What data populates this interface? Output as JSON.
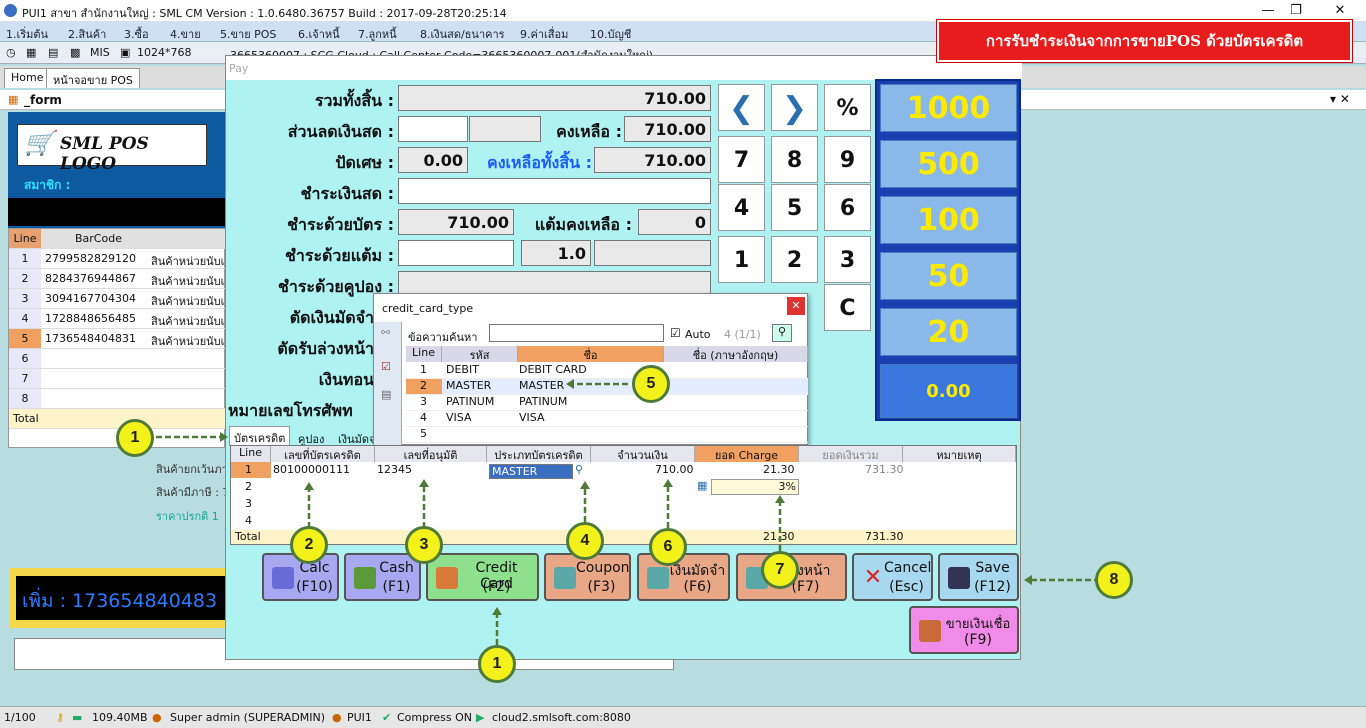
{
  "window": {
    "title": "PUI1 สาขา สำนักงานใหญ่ : SML CM Version : 1.0.6480.36757  Build : 2017-09-28T20:25:14"
  },
  "menu": [
    "1.เริ่มต้น",
    "2.สินค้า",
    "3.ซื้อ",
    "4.ขาย",
    "5.ขาย POS",
    "6.เจ้าหนี้",
    "7.ลูกหนี้",
    "8.เงินสด/ธนาคาร",
    "9.ค่าเสื่อม",
    "10.บัญชี"
  ],
  "toolbar": {
    "mis": "MIS",
    "resolution": "1024*768",
    "info": "3665360007 : SCG Cloud : Call Center Code=3665360007-001(สำนักงานใหญ่)"
  },
  "tabs": {
    "home": "Home",
    "pos": "หน้าจอขาย POS"
  },
  "form": {
    "title": "_form",
    "logo": "SML POS LOGO",
    "member": "สมาชิก :"
  },
  "bg_grid": {
    "headers": [
      "Line",
      "BarCode"
    ],
    "rows": [
      {
        "line": "1",
        "barcode": "2799582829120",
        "name": "สินค้าหน่วยนับเ"
      },
      {
        "line": "2",
        "barcode": "8284376944867",
        "name": "สินค้าหน่วยนับเ"
      },
      {
        "line": "3",
        "barcode": "3094167704304",
        "name": "สินค้าหน่วยนับเ"
      },
      {
        "line": "4",
        "barcode": "1728848656485",
        "name": "สินค้าหน่วยนับเ"
      },
      {
        "line": "5",
        "barcode": "1736548404831",
        "name": "สินค้าหน่วยนับเ"
      },
      {
        "line": "6",
        "barcode": "",
        "name": ""
      },
      {
        "line": "7",
        "barcode": "",
        "name": ""
      },
      {
        "line": "8",
        "barcode": "",
        "name": ""
      }
    ],
    "total": "Total"
  },
  "bg_info": [
    "สินค้ายกเว้นภา",
    "สินค้ามีภาษี : 7",
    "ราคาปรกติ 1"
  ],
  "bg_barcode": "เพิ่ม : 173654840483",
  "pay": {
    "title": "Pay",
    "total_label": "รวมทั้งสิ้น :",
    "total": "710.00",
    "cash_discount_label": "ส่วนลดเงินสด :",
    "remaining_label": "คงเหลือ :",
    "remaining": "710.00",
    "rounding_label": "ปัดเศษ :",
    "rounding": "0.00",
    "remaining_all_label": "คงเหลือทั้งสิ้น :",
    "remaining_all": "710.00",
    "cash_label": "ชำระเงินสด :",
    "card_label": "ชำระด้วยบัตร :",
    "card": "710.00",
    "points_left_label": "แต้มคงเหลือ :",
    "points_left": "0",
    "points_label": "ชำระด้วยแต้ม :",
    "points_rate": "1.0",
    "coupon_label": "ชำระด้วยคูปอง :",
    "deposit_label": "ตัดเงินมัดจำ",
    "advance_label": "ตัดรับล่วงหน้า",
    "change_label": "เงินทอน",
    "phone_label": "หมายเลขโทรศัพท"
  },
  "keypad": [
    "7",
    "8",
    "9",
    "4",
    "5",
    "6",
    "1",
    "2",
    "3",
    "C",
    "%"
  ],
  "notes": [
    "1000",
    "500",
    "100",
    "50",
    "20",
    "0.00"
  ],
  "banner": "การรับชำระเงินจากการขายPOS ด้วยบัตรเครดิต",
  "cc_popup": {
    "title": "credit_card_type",
    "search_label": "ข้อความค้นหา",
    "auto": "Auto",
    "count": "4 (1/1)",
    "headers": [
      "Line",
      "รหัส",
      "ชื่อ",
      "ชื่อ (ภาษาอังกฤษ)"
    ],
    "rows": [
      {
        "line": "1",
        "code": "DEBIT",
        "name": "DEBIT CARD"
      },
      {
        "line": "2",
        "code": "MASTER",
        "name": "MASTER"
      },
      {
        "line": "3",
        "code": "PATINUM",
        "name": "PATINUM"
      },
      {
        "line": "4",
        "code": "VISA",
        "name": "VISA"
      },
      {
        "line": "5",
        "code": "",
        "name": ""
      }
    ]
  },
  "paytabs": [
    "บัตรเครดิต",
    "คูปอง",
    "เงินมัดจ"
  ],
  "card_grid": {
    "headers": [
      "Line",
      "เลขที่บัตรเครดิต",
      "เลขที่อนุมัติ",
      "ประเภทบัตรเครดิต",
      "จำนวนเงิน",
      "ยอด Charge",
      "ยอดเงินรวม",
      "หมายเหตุ"
    ],
    "row1": {
      "line": "1",
      "card_no": "80100000111",
      "approval": "12345",
      "type": "MASTER",
      "amount": "710.00",
      "charge": "21.30",
      "total": "731.30"
    },
    "row2": {
      "line": "2",
      "charge": "3%"
    },
    "lines": [
      "3",
      "4"
    ],
    "total_label": "Total",
    "total_charge": "21.30",
    "total_sum": "731.30"
  },
  "buttons": {
    "calc": [
      "Calc",
      "(F10)"
    ],
    "cash": [
      "Cash",
      "(F1)"
    ],
    "credit": [
      "Credit Card",
      "(F2)"
    ],
    "coupon": [
      "Coupon",
      "(F3)"
    ],
    "deposit": [
      "เงินมัดจำ",
      "(F6)"
    ],
    "advance": [
      "ล่วงหน้า",
      "(F7)"
    ],
    "cancel": [
      "Cancel",
      "(Esc)"
    ],
    "save": [
      "Save",
      "(F12)"
    ],
    "credit_sale": [
      "ขายเงินเชื่อ",
      "(F9)"
    ]
  },
  "callouts": [
    "1",
    "2",
    "3",
    "4",
    "5",
    "6",
    "7",
    "8",
    "1"
  ],
  "status": {
    "page": "1/100",
    "mem": "109.40MB",
    "user": "Super admin (SUPERADMIN)",
    "branch": "PUI1",
    "compress": "Compress ON",
    "server": "cloud2.smlsoft.com:8080"
  },
  "colors": {
    "banner": "#e81c1c",
    "callout": "#f2f21a",
    "note_text": "#ffea00"
  }
}
